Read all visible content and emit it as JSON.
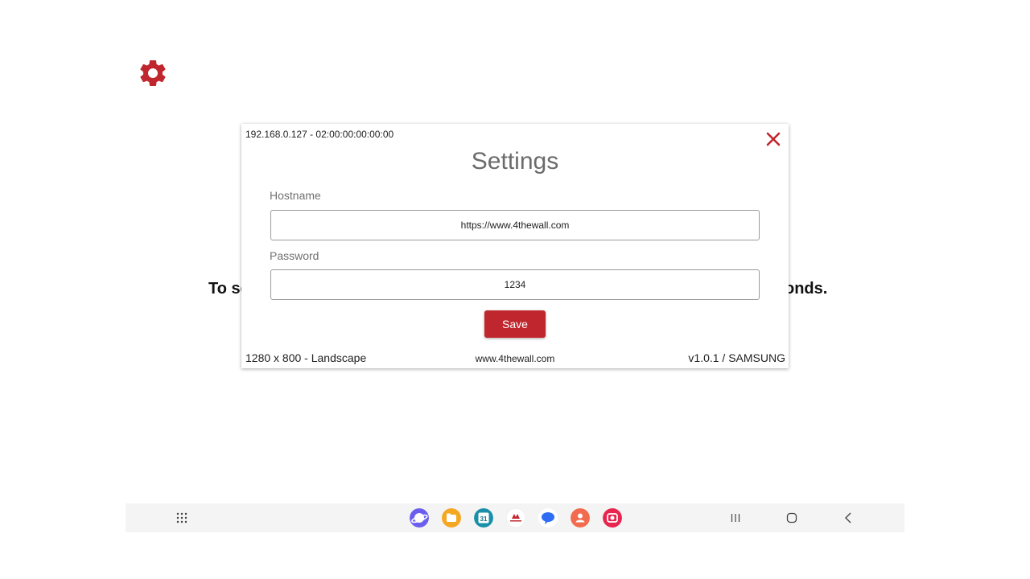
{
  "background": {
    "gear_icon": "gear-icon",
    "message_left": "To se",
    "message_right": "onds."
  },
  "dialog": {
    "network_info": "192.168.0.127 - 02:00:00:00:00:00",
    "title": "Settings",
    "hostname_label": "Hostname",
    "hostname_value": "https://www.4thewall.com",
    "password_label": "Password",
    "password_value": "1234",
    "save_label": "Save",
    "resolution": "1280 x 800 - Landscape",
    "website": "www.4thewall.com",
    "version": "v1.0.1 / SAMSUNG"
  },
  "colors": {
    "accent_red": "#c0262d",
    "title_gray": "#6b6b6b",
    "navbar_bg": "#f4f4f4"
  },
  "taskbar": {
    "apps": [
      "internet-app-icon",
      "my-files-app-icon",
      "calendar-app-icon",
      "4thewall-app-icon",
      "messages-app-icon",
      "contacts-app-icon",
      "camera-app-icon"
    ],
    "calendar_day": "31"
  }
}
